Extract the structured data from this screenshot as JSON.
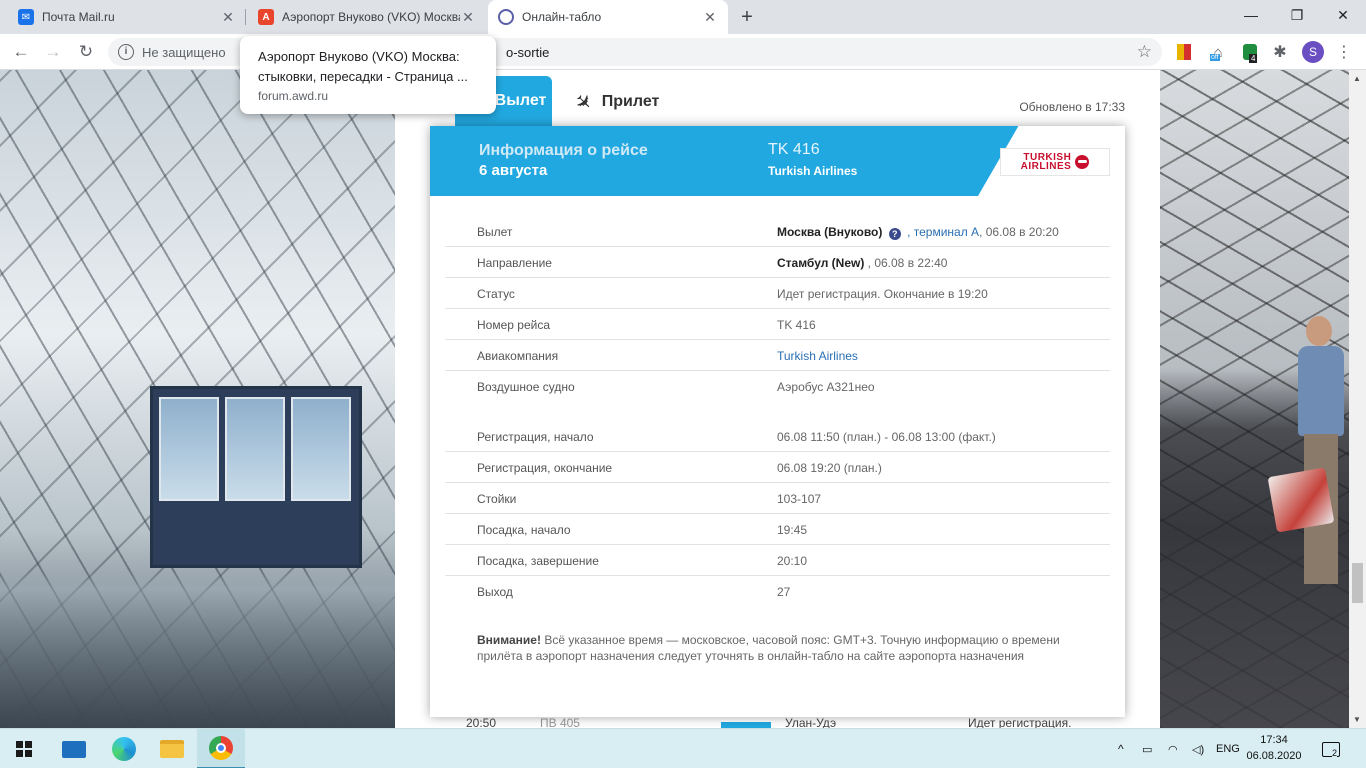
{
  "browser": {
    "tabs": [
      {
        "title": "Почта Mail.ru",
        "icon": "mail-icon",
        "active": false
      },
      {
        "title": "Аэропорт Внуково (VKO) Москва",
        "icon": "awd-icon",
        "active": false
      },
      {
        "title": "Онлайн-табло",
        "icon": "vnukovo-icon",
        "active": true
      }
    ],
    "address": {
      "security_label": "Не защищено",
      "url_visible": "o-sortie"
    },
    "tooltip": {
      "title": "Аэропорт Внуково (VKO) Москва: стыковки, пересадки - Страница ...",
      "domain": "forum.awd.ru"
    },
    "profile_initial": "S",
    "ext_badge_off": "off",
    "ext_badge_count": "4"
  },
  "page": {
    "tab_departure": "Вылет",
    "tab_arrival": "Прилет",
    "updated": "Обновлено в 17:33",
    "bottom_row": {
      "time": "20:50",
      "flight_partial": "ПВ 405",
      "city": "Улан-Удэ",
      "status": "Идет регистрация."
    }
  },
  "flight_modal": {
    "header_title": "Информация о рейсе",
    "header_date": "6 августа",
    "flight_number": "TK 416",
    "airline": "Turkish Airlines",
    "logo_text_1": "TURKISH",
    "logo_text_2": "AIRLINES",
    "close_symbol": "×",
    "rows_group1": [
      {
        "key": "Вылет",
        "value_bold": "Москва (Внуково)",
        "value_link": ", терминал А",
        "value_rest": ", 06.08 в 20:20"
      },
      {
        "key": "Направление",
        "value_bold": "Стамбул (New)",
        "value_rest": " , 06.08 в 22:40"
      },
      {
        "key": "Статус",
        "value": "Идет регистрация. Окончание в 19:20"
      },
      {
        "key": "Номер рейса",
        "value": "TK 416"
      },
      {
        "key": "Авиакомпания",
        "value_link_only": "Turkish Airlines"
      },
      {
        "key": "Воздушное судно",
        "value": "Аэробус А321нео"
      }
    ],
    "rows_group2": [
      {
        "key": "Регистрация, начало",
        "value": "06.08 11:50 (план.) - 06.08 13:00 (факт.)"
      },
      {
        "key": "Регистрация, окончание",
        "value": "06.08 19:20 (план.)"
      },
      {
        "key": "Стойки",
        "value": "103-107"
      },
      {
        "key": "Посадка, начало",
        "value": "19:45"
      },
      {
        "key": "Посадка, завершение",
        "value": "20:10"
      },
      {
        "key": "Выход",
        "value": "27"
      }
    ],
    "note_bold": "Внимание!",
    "note_text": " Всё указанное время — московское, часовой пояс: GMT+3. Точную информацию о времени прилёта в аэропорт назначения следует уточнять в онлайн-табло на сайте аэропорта назначения"
  },
  "taskbar": {
    "language": "ENG",
    "time": "17:34",
    "date": "06.08.2020",
    "notifications": "2"
  },
  "colors": {
    "accent": "#22a8e0",
    "turkish_red": "#c8102e",
    "link": "#2a6fb3"
  }
}
